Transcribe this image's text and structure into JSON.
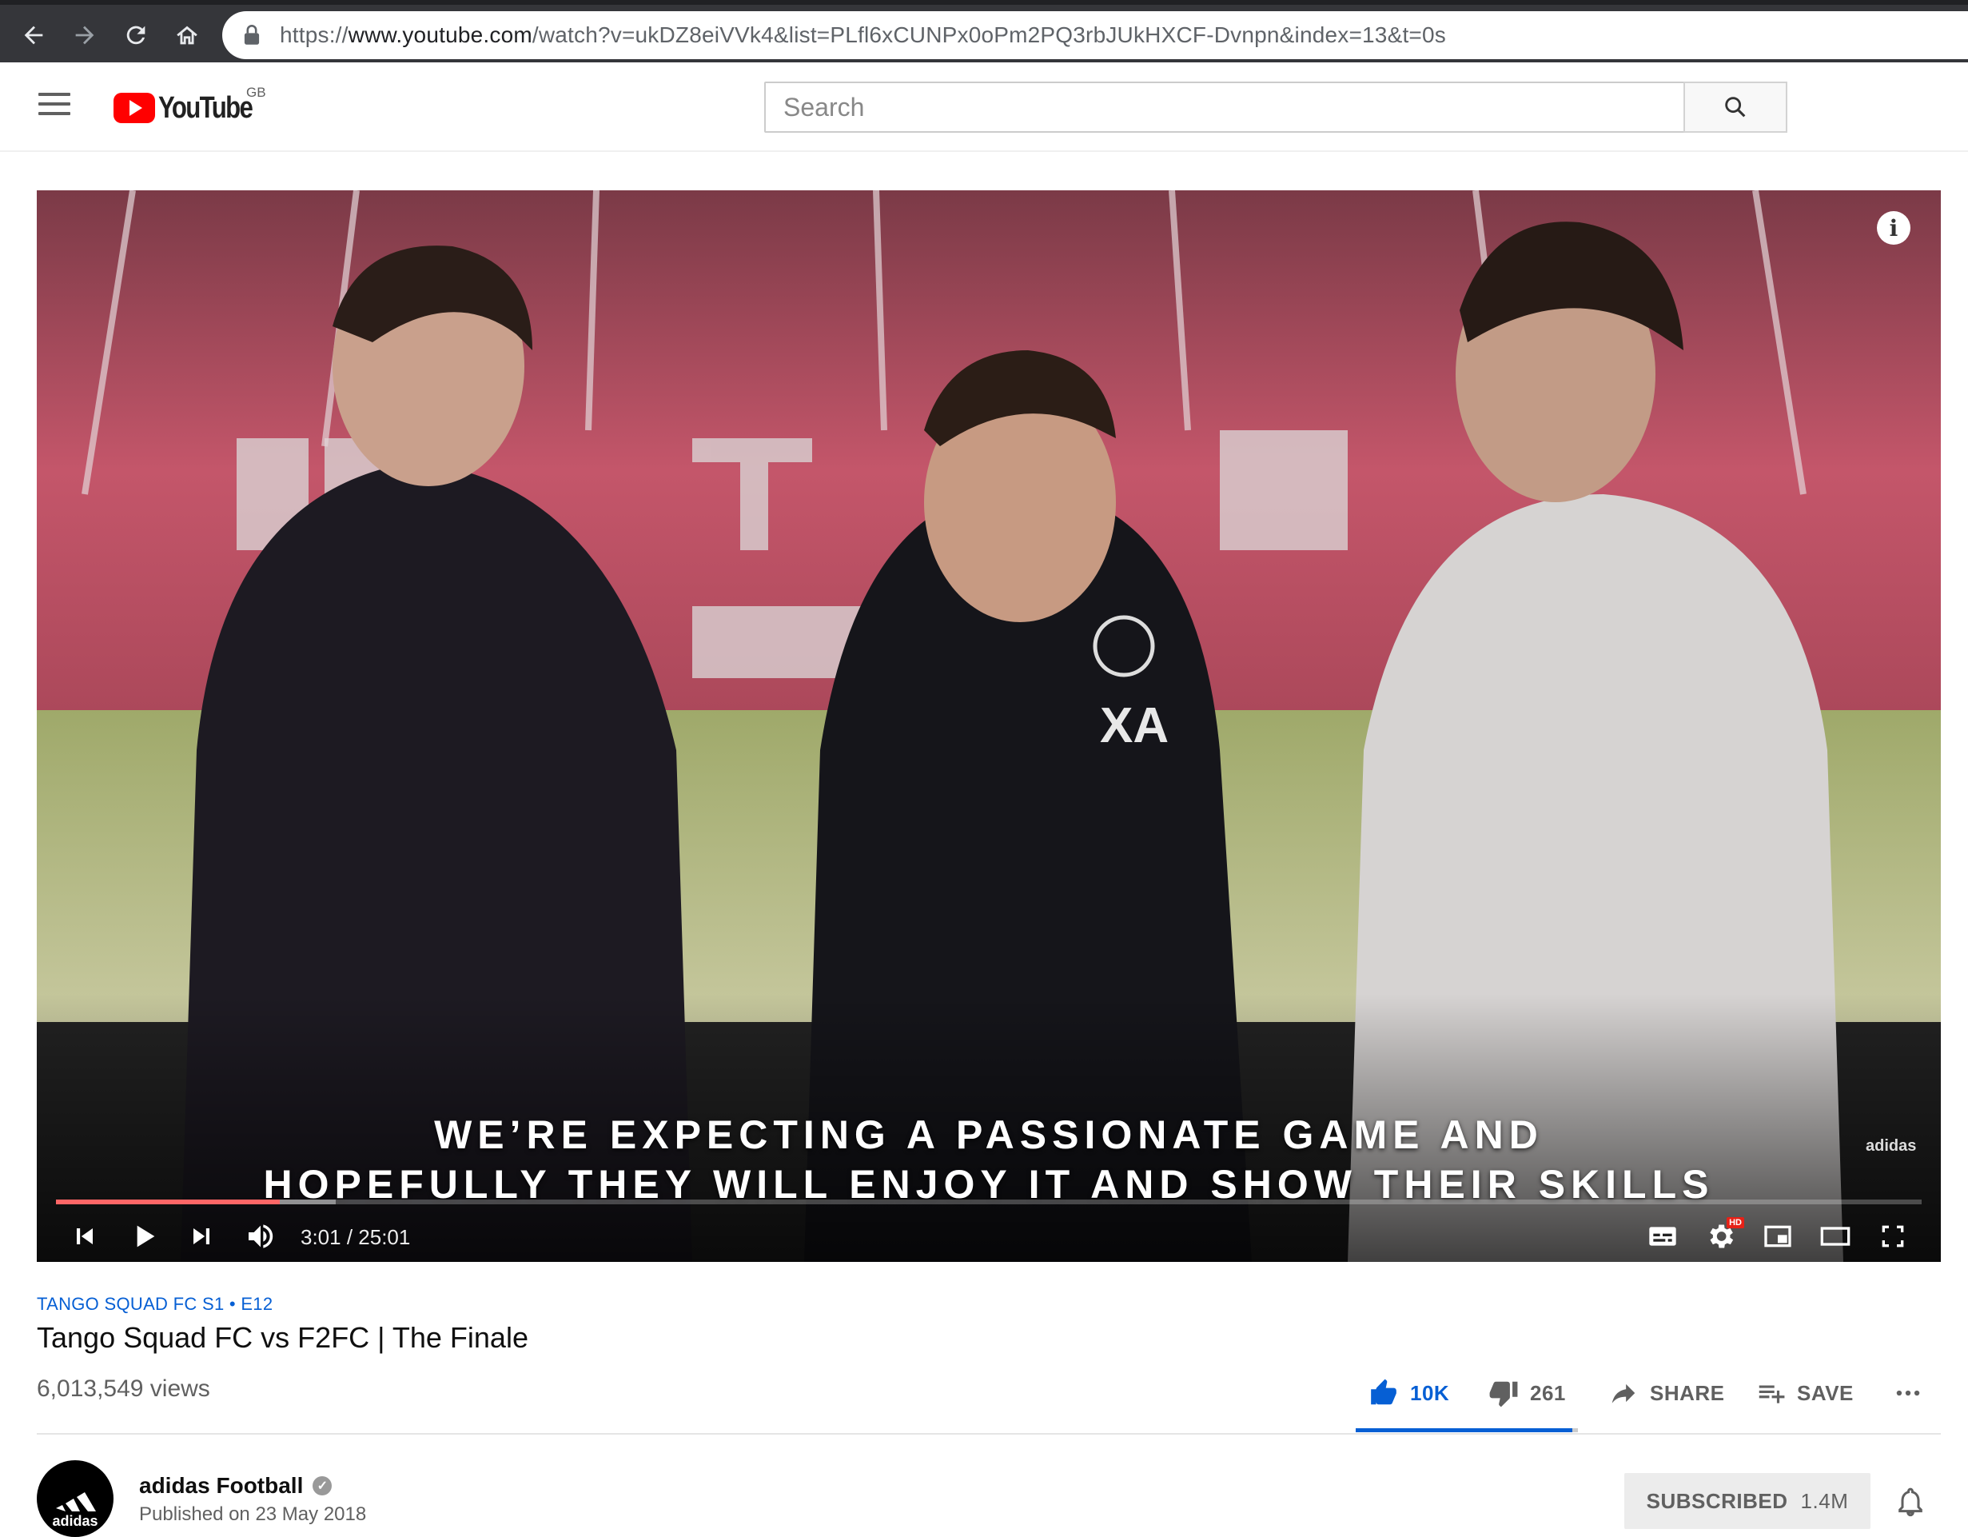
{
  "browser": {
    "url_scheme": "https://",
    "url_host": "www.youtube.com",
    "url_path": "/watch?v=ukDZ8eiVVk4&list=PLfl6xCUNPx0oPm2PQ3rbJUkHXCF-Dvnpn&index=13&t=0s"
  },
  "header": {
    "logo_text": "YouTube",
    "country_code": "GB",
    "search_placeholder": "Search"
  },
  "player": {
    "caption_line1": "WE’RE EXPECTING A PASSIONATE GAME AND",
    "caption_line2": "HOPEFULLY THEY WILL ENJOY IT AND SHOW THEIR SKILLS",
    "watermark": "adidas",
    "time_display": "3:01 / 25:01",
    "progress_fraction": 0.12,
    "buffer_fraction": 0.15,
    "hd_badge": "HD"
  },
  "video": {
    "series": "TANGO SQUAD FC  S1 • E12",
    "title": "Tango Squad FC vs F2FC | The Finale",
    "views": "6,013,549 views",
    "likes": "10K",
    "dislikes": "261",
    "share_label": "SHARE",
    "save_label": "SAVE",
    "like_fraction": 0.975
  },
  "channel": {
    "name": "adidas Football",
    "published": "Published on 23 May 2018",
    "subscribe_label": "SUBSCRIBED",
    "subscriber_count": "1.4M",
    "avatar_text": "adidas"
  },
  "colors": {
    "brand_red": "#ff0000",
    "link_blue": "#065fd4"
  }
}
